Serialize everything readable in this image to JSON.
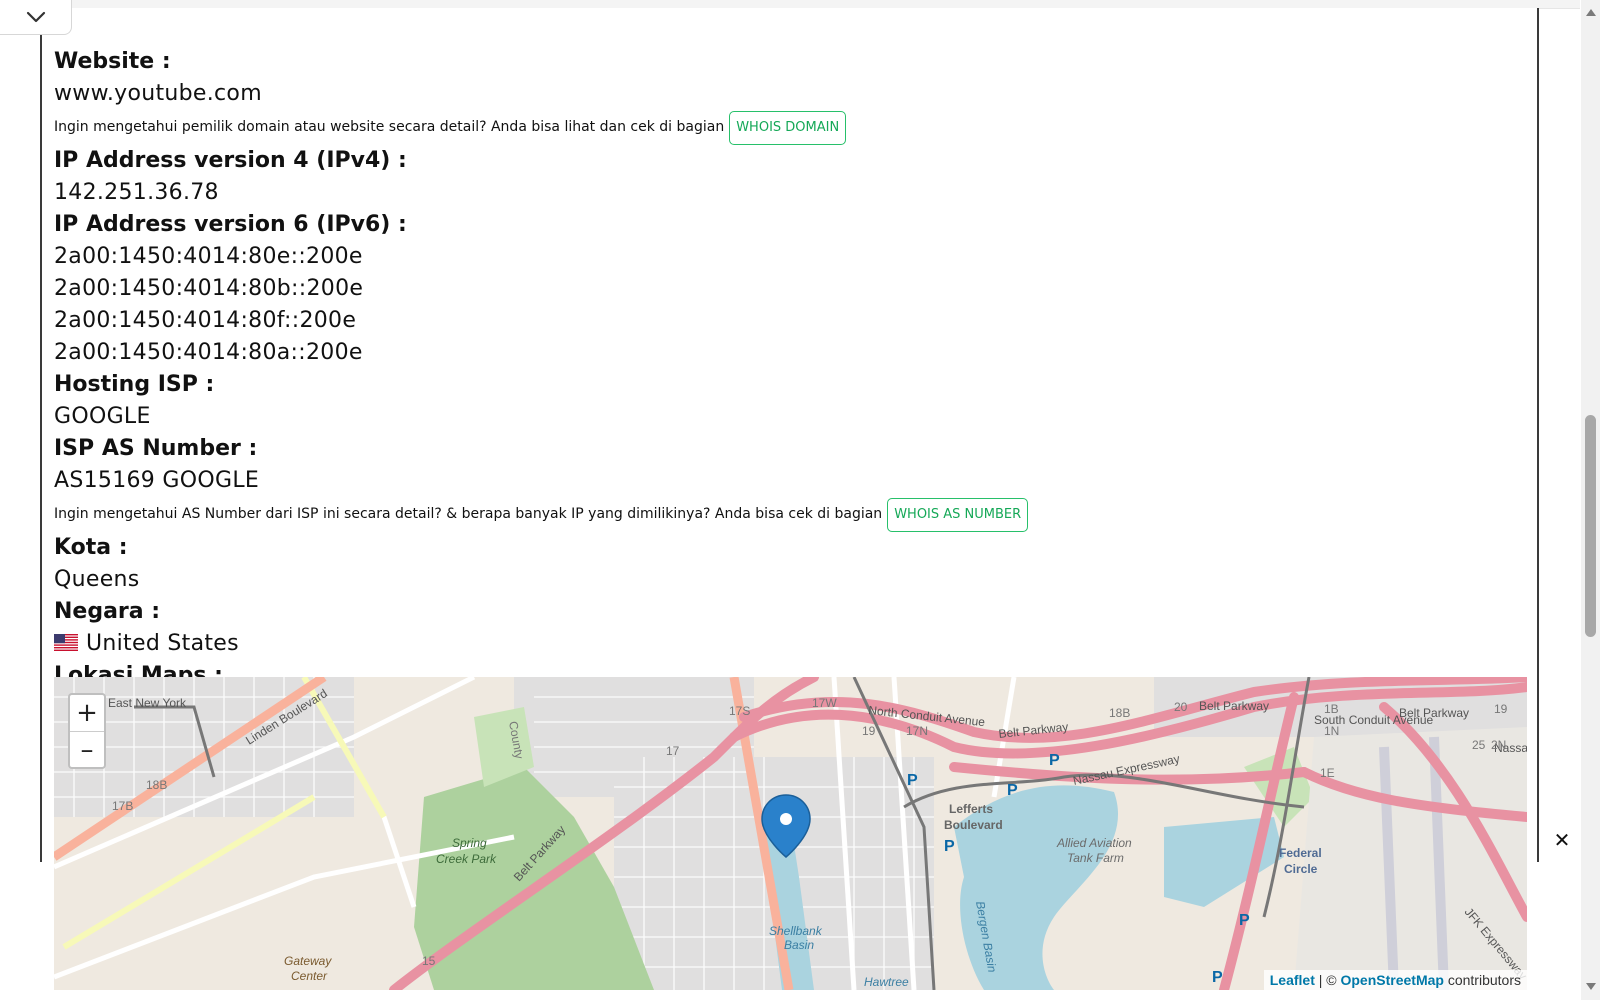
{
  "website": {
    "label": "Website :",
    "value": "www.youtube.com",
    "note": "Ingin mengetahui pemilik domain atau website secara detail? Anda bisa lihat dan cek di bagian",
    "button": "WHOIS DOMAIN"
  },
  "ipv4": {
    "label": "IP Address version 4 (IPv4) :",
    "value": "142.251.36.78"
  },
  "ipv6": {
    "label": "IP Address version 6 (IPv6) :",
    "values": [
      "2a00:1450:4014:80e::200e",
      "2a00:1450:4014:80b::200e",
      "2a00:1450:4014:80f::200e",
      "2a00:1450:4014:80a::200e"
    ]
  },
  "isp": {
    "label": "Hosting ISP :",
    "value": "GOOGLE"
  },
  "asn": {
    "label": "ISP AS Number :",
    "value": "AS15169 GOOGLE",
    "note": "Ingin mengetahui AS Number dari ISP ini secara detail? & berapa banyak IP yang dimilikinya? Anda bisa cek di bagian",
    "button": "WHOIS AS NUMBER"
  },
  "city": {
    "label": "Kota :",
    "value": "Queens"
  },
  "country": {
    "label": "Negara :",
    "value": "United States",
    "flag_icon": "us-flag-icon"
  },
  "maps": {
    "label": "Lokasi Maps :",
    "zoom_in": "+",
    "zoom_out": "–",
    "place_labels": {
      "east_new_york": "East New York",
      "linden": "Linden Boulevard",
      "north_conduit": "North Conduit Avenue",
      "belt_parkway_1": "Belt Parkway",
      "belt_parkway_2": "Belt Parkway",
      "belt_parkway_3": "Belt Parkway",
      "belt_parkway_4": "Belt Parkway",
      "south_conduit": "South Conduit Avenue",
      "nassau": "Nassau Expressway",
      "lefferts": "Lefferts",
      "boulevard": "Boulevard",
      "allied1": "Allied Aviation",
      "allied2": "Tank Farm",
      "federal": "Federal",
      "circle": "Circle",
      "spring": "Spring",
      "creek": "Creek Park",
      "gateway": "Gateway",
      "center": "Center",
      "shellbank": "Shellbank",
      "basin": "Basin",
      "hawtree": "Hawtree",
      "bergen": "Bergen Basin",
      "jfk": "JFK Expressway",
      "nassau_short": "Nassau",
      "county": "County",
      "exit_17s": "17S",
      "exit_17w": "17W",
      "exit_17n": "17N",
      "exit_17": "17",
      "exit_18b_left": "18B",
      "exit_17b": "17B",
      "exit_18b": "18B",
      "exit_19": "19",
      "exit_19_r": "19",
      "exit_20": "20",
      "exit_1b": "1B",
      "exit_1n": "1N",
      "exit_25": "25",
      "exit_2n": "2N",
      "exit_1e": "1E",
      "exit_15": "15",
      "parking": "P"
    },
    "attribution": {
      "leaflet": "Leaflet",
      "sep": " | © ",
      "osm": "OpenStreetMap",
      "rest": " contributors"
    },
    "colors": {
      "motorway": "#e892a2",
      "trunk": "#f9b29c",
      "road": "#ffffff",
      "water": "#aad3df",
      "park": "#add19e",
      "land": "#efe9e0",
      "residential": "#e0dfdf",
      "marker": "#2a81cb"
    }
  },
  "close_label": "✕"
}
